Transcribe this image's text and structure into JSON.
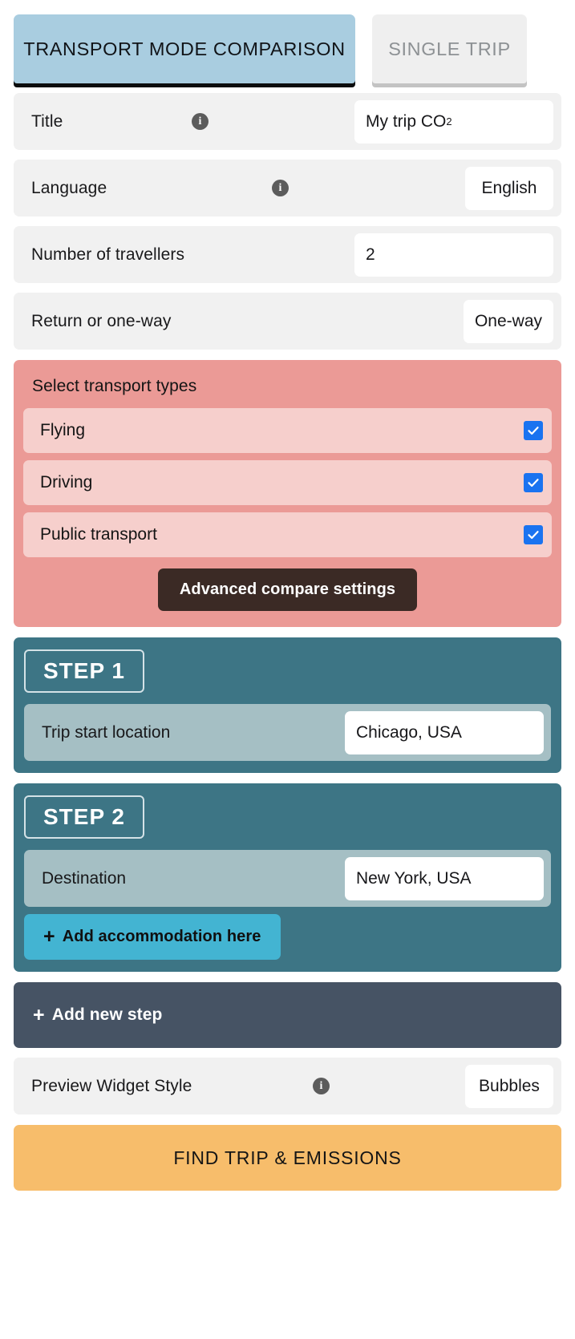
{
  "tabs": [
    {
      "label": "TRANSPORT MODE COMPARISON",
      "active": true
    },
    {
      "label": "SINGLE TRIP",
      "active": false
    }
  ],
  "settings": {
    "title": {
      "label": "Title",
      "value_prefix": "My trip CO",
      "value_sub": "2",
      "info": "info-icon"
    },
    "language": {
      "label": "Language",
      "value": "English",
      "info": "info-icon"
    },
    "travellers": {
      "label": "Number of travellers",
      "value": "2"
    },
    "return_or_oneway": {
      "label": "Return or one-way",
      "value": "One-way"
    }
  },
  "transport": {
    "heading": "Select transport types",
    "items": [
      {
        "label": "Flying",
        "checked": true
      },
      {
        "label": "Driving",
        "checked": true
      },
      {
        "label": "Public transport",
        "checked": true
      }
    ],
    "advanced_label": "Advanced compare settings"
  },
  "steps": [
    {
      "badge": "STEP 1",
      "field_label": "Trip start location",
      "field_value": "Chicago, USA",
      "accommodation_label": null
    },
    {
      "badge": "STEP 2",
      "field_label": "Destination",
      "field_value": "New York, USA",
      "accommodation_label": "Add accommodation here"
    }
  ],
  "add_step": {
    "label": "Add new step",
    "plus": "+"
  },
  "preview": {
    "label": "Preview Widget Style",
    "value": "Bubbles",
    "info": "info-icon"
  },
  "cta": {
    "label": "FIND TRIP & EMISSIONS"
  },
  "colors": {
    "active_tab": "#a9cde0",
    "inactive_tab": "#efefef",
    "transport_panel": "#eb9a96",
    "transport_item": "#f6cfcc",
    "checkbox": "#1a73f0",
    "advanced_btn": "#3b2a25",
    "step_panel": "#3d7585",
    "step_row": "#a5bfc4",
    "accommodation_btn": "#43b4d2",
    "add_step": "#465364",
    "cta": "#f7bd6b",
    "row_bg": "#f1f1f1"
  }
}
